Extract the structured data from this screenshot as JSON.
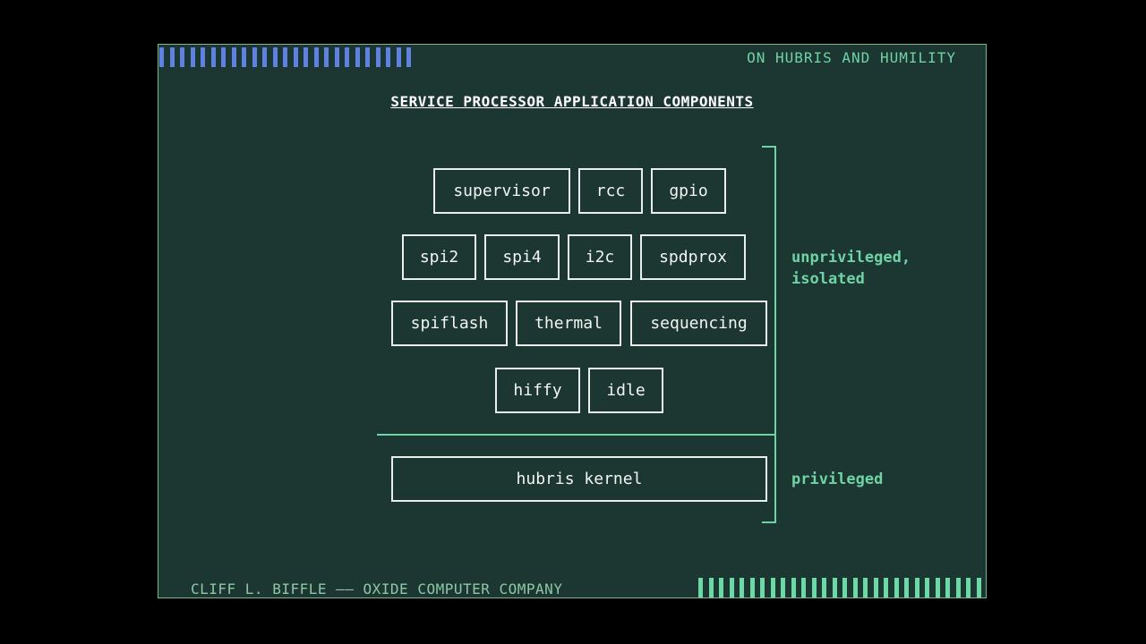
{
  "header": "ON HUBRIS AND HUMILITY",
  "title": "SERVICE PROCESSOR APPLICATION COMPONENTS",
  "footer": "CLIFF L. BIFFLE —— OXIDE COMPUTER COMPANY",
  "rows": [
    [
      "supervisor",
      "rcc",
      "gpio"
    ],
    [
      "spi2",
      "spi4",
      "i2c",
      "spdprox"
    ],
    [
      "spiflash",
      "thermal",
      "sequencing"
    ],
    [
      "hiffy",
      "idle"
    ]
  ],
  "kernel": "hubris kernel",
  "labels": {
    "unprivileged": "unprivileged,\nisolated",
    "privileged": "privileged"
  },
  "colors": {
    "background": "#1c3631",
    "accent": "#6fd3a5",
    "blue_bars": "#5f82e0"
  }
}
